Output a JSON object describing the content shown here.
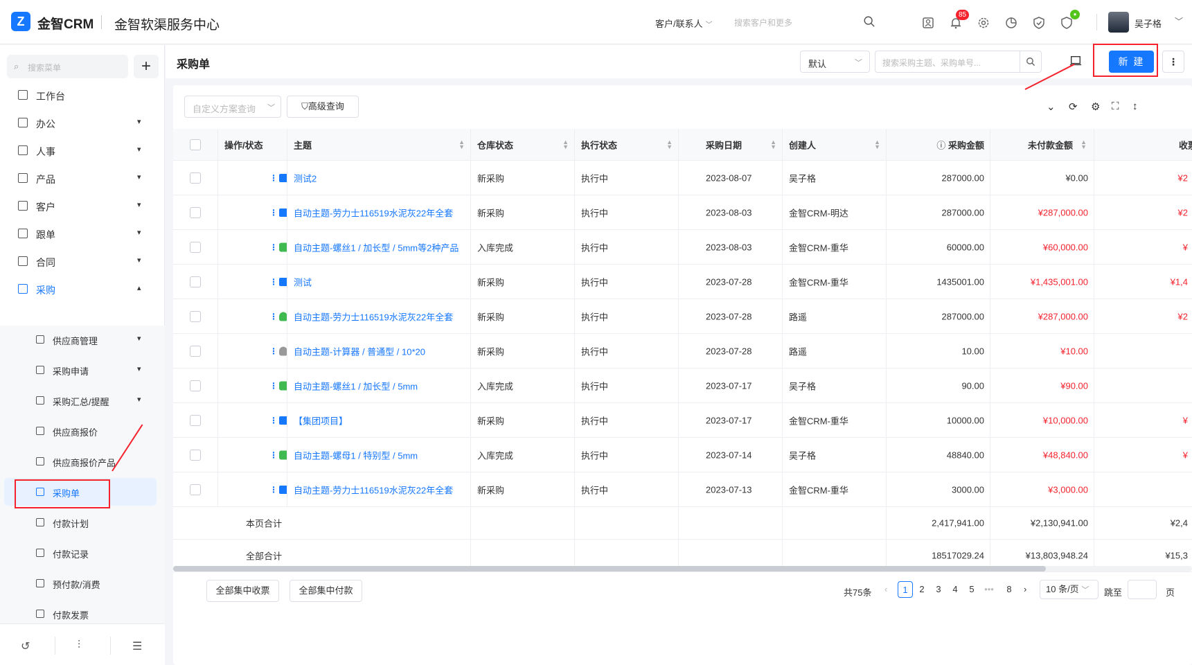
{
  "app": {
    "brand": "金智CRM",
    "center_title": "金智软渠服务中心",
    "search_type": "客户/联系人",
    "search_placeholder": "搜索客户和更多",
    "notification_count": "85",
    "user_name": "吴子格"
  },
  "sidebar": {
    "search_placeholder": "搜索菜单",
    "items": [
      {
        "label": "工作台",
        "icon": "workbench-icon"
      },
      {
        "label": "办公",
        "icon": "office-icon"
      },
      {
        "label": "人事",
        "icon": "hr-icon"
      },
      {
        "label": "产品",
        "icon": "product-icon"
      },
      {
        "label": "客户",
        "icon": "customer-icon"
      },
      {
        "label": "跟单",
        "icon": "follow-icon"
      },
      {
        "label": "合同",
        "icon": "contract-icon"
      },
      {
        "label": "采购",
        "icon": "purchase-icon"
      }
    ],
    "sub_items": [
      {
        "label": "供应商管理"
      },
      {
        "label": "采购申请"
      },
      {
        "label": "采购汇总/提醒"
      },
      {
        "label": "供应商报价"
      },
      {
        "label": "供应商报价产品"
      },
      {
        "label": "采购单"
      },
      {
        "label": "付款计划"
      },
      {
        "label": "付款记录"
      },
      {
        "label": "预付款/消费"
      },
      {
        "label": "付款发票"
      }
    ]
  },
  "header": {
    "title": "采购单",
    "view_value": "默认",
    "search_placeholder": "搜索采购主题、采购单号...",
    "new_label": "新 建"
  },
  "toolbar": {
    "custom_query_placeholder": "自定义方案查询",
    "advanced_query": "高级查询"
  },
  "table": {
    "columns": [
      "操作/状态",
      "主题",
      "仓库状态",
      "执行状态",
      "采购日期",
      "创建人",
      "采购金额",
      "未付款金额",
      "收票"
    ],
    "rows": [
      {
        "subject": "测试2",
        "warehouse": "新采购",
        "exec": "执行中",
        "date": "2023-08-07",
        "creator": "吴子格",
        "amount": "287000.00",
        "unpaid": "¥0.00",
        "extra": "¥2",
        "ops": [
          "basket",
          "play"
        ]
      },
      {
        "subject": "自动主题-劳力士116519水泥灰22年全套",
        "warehouse": "新采购",
        "exec": "执行中",
        "date": "2023-08-03",
        "creator": "金智CRM-明达",
        "amount": "287000.00",
        "unpaid": "¥287,000.00",
        "extra": "¥2",
        "ops": [
          "basket",
          "play"
        ]
      },
      {
        "subject": "自动主题-螺丝1 / 加长型 / 5mm等2种产品",
        "warehouse": "入库完成",
        "exec": "执行中",
        "date": "2023-08-03",
        "creator": "金智CRM-重华",
        "amount": "60000.00",
        "unpaid": "¥60,000.00",
        "extra": "¥",
        "ops": [
          "green",
          "play"
        ]
      },
      {
        "subject": "测试",
        "warehouse": "新采购",
        "exec": "执行中",
        "date": "2023-07-28",
        "creator": "金智CRM-重华",
        "amount": "1435001.00",
        "unpaid": "¥1,435,001.00",
        "extra": "¥1,4",
        "ops": [
          "basket",
          "play"
        ]
      },
      {
        "subject": "自动主题-劳力士116519水泥灰22年全套",
        "warehouse": "新采购",
        "exec": "执行中",
        "date": "2023-07-28",
        "creator": "路遥",
        "amount": "287000.00",
        "unpaid": "¥287,000.00",
        "extra": "¥2",
        "ops": [
          "user-green",
          "basket",
          "play"
        ]
      },
      {
        "subject": "自动主题-计算器 / 普通型 / 10*20",
        "warehouse": "新采购",
        "exec": "执行中",
        "date": "2023-07-28",
        "creator": "路遥",
        "amount": "10.00",
        "unpaid": "¥10.00",
        "extra": "",
        "ops": [
          "user-gray",
          "basket",
          "play"
        ]
      },
      {
        "subject": "自动主题-螺丝1 / 加长型 / 5mm",
        "warehouse": "入库完成",
        "exec": "执行中",
        "date": "2023-07-17",
        "creator": "吴子格",
        "amount": "90.00",
        "unpaid": "¥90.00",
        "extra": "",
        "ops": [
          "green",
          "play"
        ]
      },
      {
        "subject": "【集团项目】",
        "warehouse": "新采购",
        "exec": "执行中",
        "date": "2023-07-17",
        "creator": "金智CRM-重华",
        "amount": "10000.00",
        "unpaid": "¥10,000.00",
        "extra": "¥",
        "ops": [
          "basket",
          "play"
        ]
      },
      {
        "subject": "自动主题-螺母1 / 特别型 / 5mm",
        "warehouse": "入库完成",
        "exec": "执行中",
        "date": "2023-07-14",
        "creator": "吴子格",
        "amount": "48840.00",
        "unpaid": "¥48,840.00",
        "extra": "¥",
        "ops": [
          "green",
          "play"
        ]
      },
      {
        "subject": "自动主题-劳力士116519水泥灰22年全套",
        "warehouse": "新采购",
        "exec": "执行中",
        "date": "2023-07-13",
        "creator": "金智CRM-重华",
        "amount": "3000.00",
        "unpaid": "¥3,000.00",
        "extra": "",
        "ops": [
          "basket",
          "play"
        ]
      }
    ],
    "page_total": {
      "label": "本页合计",
      "amount": "2,417,941.00",
      "unpaid": "¥2,130,941.00",
      "extra": "¥2,4"
    },
    "all_total": {
      "label": "全部合计",
      "amount": "18517029.24",
      "unpaid": "¥13,803,948.24",
      "extra": "¥15,3"
    }
  },
  "footer": {
    "btn1": "全部集中收票",
    "btn2": "全部集中付款",
    "total_text": "共75条",
    "pages": [
      "1",
      "2",
      "3",
      "4",
      "5",
      "•••",
      "8"
    ],
    "page_size": "10 条/页",
    "jump_label": "跳至",
    "page_suffix": "页"
  },
  "colors": {
    "accent": "#1677ff",
    "danger": "#f5222d",
    "success": "#3fb950",
    "warning": "#f5a623"
  }
}
